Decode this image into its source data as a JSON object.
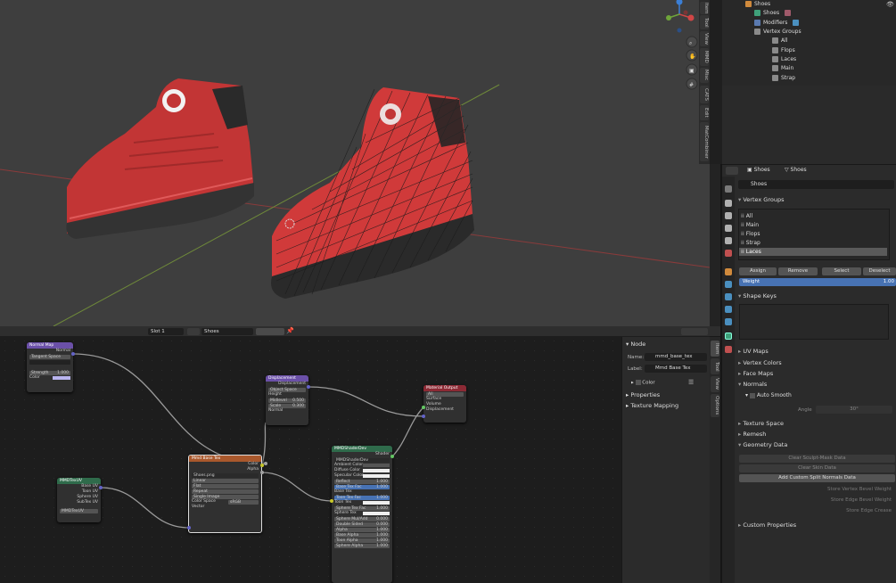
{
  "viewport": {
    "side_tabs": [
      "Item",
      "Tool",
      "View",
      "MMD",
      "Misc",
      "CATS",
      "Edit",
      "MatCombiner"
    ]
  },
  "outliner": {
    "items": [
      {
        "label": "Shoes",
        "level": 0
      },
      {
        "label": "Shoes",
        "level": 1
      },
      {
        "label": "Modifiers",
        "level": 1
      },
      {
        "label": "Vertex Groups",
        "level": 1
      },
      {
        "label": "All",
        "level": 2
      },
      {
        "label": "Flops",
        "level": 2
      },
      {
        "label": "Laces",
        "level": 2
      },
      {
        "label": "Main",
        "level": 2
      },
      {
        "label": "Strap",
        "level": 2
      }
    ]
  },
  "properties": {
    "header_object": "Shoes",
    "header_data": "Shoes",
    "mesh_name": "Shoes",
    "vertex_groups_title": "Vertex Groups",
    "vertex_groups": [
      "All",
      "Main",
      "Flops",
      "Strap",
      "Laces"
    ],
    "vg_buttons": {
      "assign": "Assign",
      "remove": "Remove",
      "select": "Select",
      "deselect": "Deselect"
    },
    "weight_label": "Weight",
    "weight_value": "1.00",
    "shape_keys": "Shape Keys",
    "uv_maps": "UV Maps",
    "vertex_colors": "Vertex Colors",
    "face_maps": "Face Maps",
    "normals": "Normals",
    "auto_smooth": "Auto Smooth",
    "angle_label": "Angle",
    "angle_value": "30°",
    "texture_space": "Texture Space",
    "remesh": "Remesh",
    "geometry_data": "Geometry Data",
    "clear_sculpt": "Clear Sculpt-Mask Data",
    "clear_skin": "Clear Skin Data",
    "add_split": "Add Custom Split Normals Data",
    "store_vertex_bevel": "Store Vertex Bevel Weight",
    "store_edge_bevel": "Store Edge Bevel Weight",
    "store_edge_crease": "Store Edge Crease",
    "custom_properties": "Custom Properties"
  },
  "node_header": {
    "slot": "Slot 1",
    "material": "Shoes"
  },
  "npanel": {
    "node_title": "Node",
    "name_label": "Name:",
    "name_value": "mmd_base_tex",
    "label_label": "Label:",
    "label_value": "Mmd Base Tex",
    "color_label": "Color",
    "properties": "Properties",
    "texture_mapping": "Texture Mapping",
    "tabs": [
      "Item",
      "Tool",
      "View",
      "Options"
    ]
  },
  "nodes": {
    "normal_map": {
      "title": "Normal Map",
      "out": "Normal",
      "space": "Tangent Space",
      "strength_label": "Strength",
      "strength": "1.000",
      "color_label": "Color"
    },
    "displacement": {
      "title": "Displacement",
      "out": "Displacement",
      "space": "Object Space",
      "height": "Height",
      "midlevel_label": "Midlevel",
      "midlevel": "0.500",
      "scale_label": "Scale",
      "scale": "0.300",
      "normal": "Normal"
    },
    "material_output": {
      "title": "Material Output",
      "target": "All",
      "surface": "Surface",
      "volume": "Volume",
      "displacement": "Displacement"
    },
    "mmd_tex_uv": {
      "title": "MMDTexUV",
      "base_uv": "Base UV",
      "toon_uv": "Toon UV",
      "sphere_uv": "Sphere UV",
      "subtex_uv": "SubTex UV",
      "group": "MMDTexUV"
    },
    "base_tex": {
      "title": "Mmd Base Tex",
      "color": "Color",
      "alpha": "Alpha",
      "image": "Shoes.png",
      "interp": "Linear",
      "proj": "Flat",
      "ext": "Repeat",
      "source": "Single Image",
      "cs_label": "Color Space",
      "cs_value": "sRGB",
      "vector": "Vector"
    },
    "shader": {
      "title": "MMDShaderDev",
      "out": "Shader",
      "group": "MMDShaderDev",
      "rows": [
        {
          "label": "Ambient Color",
          "value": ""
        },
        {
          "label": "Diffuse Color",
          "value": ""
        },
        {
          "label": "Specular Color",
          "value": ""
        },
        {
          "label": "Reflect",
          "value": "1.000"
        },
        {
          "label": "Base Tex Fac",
          "value": "1.000"
        },
        {
          "label": "Base Tex",
          "value": ""
        },
        {
          "label": "Toon Tex Fac",
          "value": "1.000"
        },
        {
          "label": "Toon Tex",
          "value": ""
        },
        {
          "label": "Sphere Tex Fac",
          "value": "1.000"
        },
        {
          "label": "Sphere Tex",
          "value": ""
        },
        {
          "label": "Sphere Mul/Add",
          "value": "0.000"
        },
        {
          "label": "Double Sided",
          "value": "0.000"
        },
        {
          "label": "Alpha",
          "value": "1.000"
        },
        {
          "label": "Base Alpha",
          "value": "1.000"
        },
        {
          "label": "Toon Alpha",
          "value": "1.000"
        },
        {
          "label": "Sphere Alpha",
          "value": "1.000"
        }
      ]
    }
  }
}
